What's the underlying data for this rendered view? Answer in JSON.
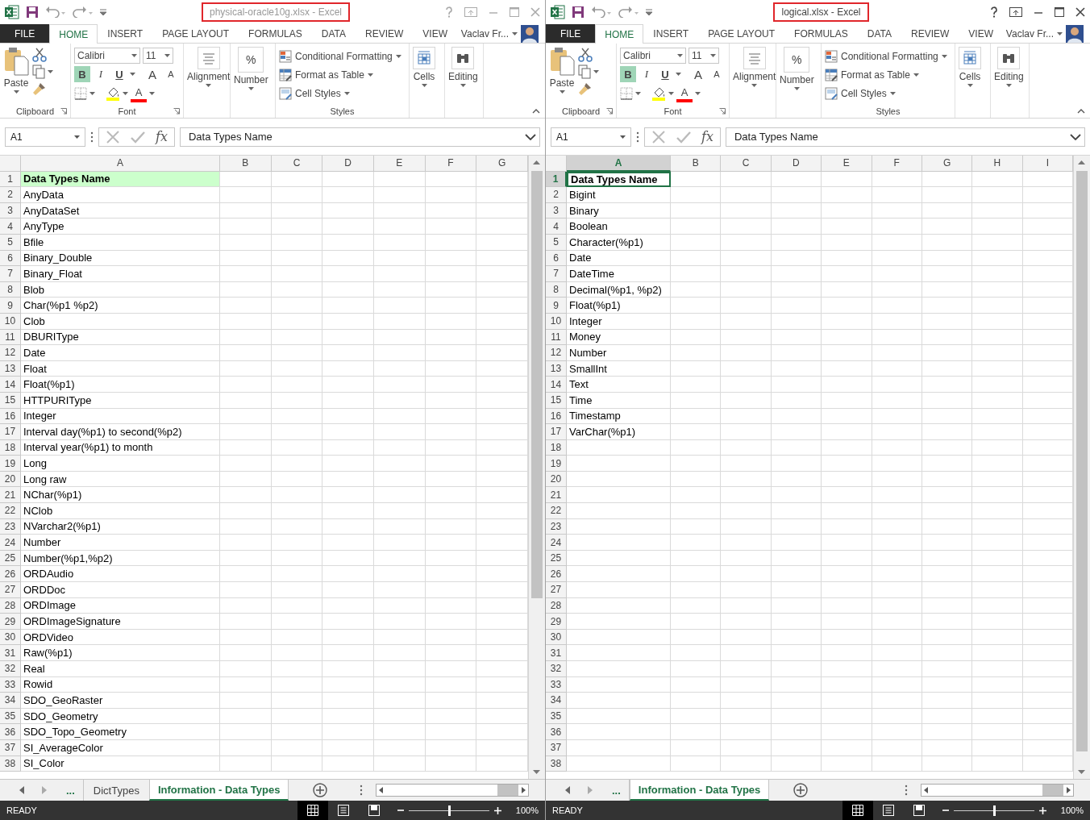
{
  "windows": [
    {
      "active": false,
      "title": "physical-oracle10g.xlsx - Excel",
      "title_marked": true,
      "tabs": [
        {
          "label": "FILE",
          "kind": "file",
          "selected": false
        },
        {
          "label": "HOME",
          "kind": "tab",
          "selected": true
        },
        {
          "label": "INSERT",
          "kind": "tab",
          "selected": false
        },
        {
          "label": "PAGE LAYOUT",
          "kind": "tab",
          "selected": false
        },
        {
          "label": "FORMULAS",
          "kind": "tab",
          "selected": false
        },
        {
          "label": "DATA",
          "kind": "tab",
          "selected": false
        },
        {
          "label": "REVIEW",
          "kind": "tab",
          "selected": false
        },
        {
          "label": "VIEW",
          "kind": "tab",
          "selected": false
        }
      ],
      "user": "Vaclav Fr...",
      "ribbon": {
        "paste": "Paste",
        "font_name": "Calibri",
        "font_size": "11",
        "bold": "B",
        "bold_on": true,
        "italic": "I",
        "underline": "U",
        "grow_font": "A",
        "shrink_font": "A",
        "font_color": "A",
        "alignment": "Alignment",
        "number_glyph": "%",
        "number": "Number",
        "styles_items": [
          "Conditional Formatting",
          "Format as Table",
          "Cell Styles"
        ],
        "cells": "Cells",
        "editing": "Editing",
        "groups": [
          "Clipboard",
          "Font",
          "Styles"
        ]
      },
      "name_box": "A1",
      "function_label": "fx",
      "formula": "Data Types Name",
      "columns": [
        {
          "label": "A",
          "selected": false
        },
        {
          "label": "B",
          "selected": false
        },
        {
          "label": "C",
          "selected": false
        },
        {
          "label": "D",
          "selected": false
        },
        {
          "label": "E",
          "selected": false
        },
        {
          "label": "F",
          "selected": false
        },
        {
          "label": "G",
          "selected": false
        }
      ],
      "header_row": {
        "n": "1",
        "text": "Data Types Name",
        "highlighted": true,
        "active": false
      },
      "rows": [
        {
          "n": "2",
          "a": "AnyData"
        },
        {
          "n": "3",
          "a": "AnyDataSet"
        },
        {
          "n": "4",
          "a": "AnyType"
        },
        {
          "n": "5",
          "a": "Bfile"
        },
        {
          "n": "6",
          "a": "Binary_Double"
        },
        {
          "n": "7",
          "a": "Binary_Float"
        },
        {
          "n": "8",
          "a": "Blob"
        },
        {
          "n": "9",
          "a": "Char(%p1 %p2)"
        },
        {
          "n": "10",
          "a": "Clob"
        },
        {
          "n": "11",
          "a": "DBURIType"
        },
        {
          "n": "12",
          "a": "Date"
        },
        {
          "n": "13",
          "a": "Float"
        },
        {
          "n": "14",
          "a": "Float(%p1)"
        },
        {
          "n": "15",
          "a": "HTTPURIType"
        },
        {
          "n": "16",
          "a": "Integer"
        },
        {
          "n": "17",
          "a": "Interval day(%p1) to second(%p2)"
        },
        {
          "n": "18",
          "a": "Interval year(%p1) to month"
        },
        {
          "n": "19",
          "a": "Long"
        },
        {
          "n": "20",
          "a": "Long raw"
        },
        {
          "n": "21",
          "a": "NChar(%p1)"
        },
        {
          "n": "22",
          "a": "NClob"
        },
        {
          "n": "23",
          "a": "NVarchar2(%p1)"
        },
        {
          "n": "24",
          "a": "Number"
        },
        {
          "n": "25",
          "a": "Number(%p1,%p2)"
        },
        {
          "n": "26",
          "a": "ORDAudio"
        },
        {
          "n": "27",
          "a": "ORDDoc"
        },
        {
          "n": "28",
          "a": "ORDImage"
        },
        {
          "n": "29",
          "a": "ORDImageSignature"
        },
        {
          "n": "30",
          "a": "ORDVideo"
        },
        {
          "n": "31",
          "a": "Raw(%p1)"
        },
        {
          "n": "32",
          "a": "Real"
        },
        {
          "n": "33",
          "a": "Rowid"
        },
        {
          "n": "34",
          "a": "SDO_GeoRaster"
        },
        {
          "n": "35",
          "a": "SDO_Geometry"
        },
        {
          "n": "36",
          "a": "SDO_Topo_Geometry"
        },
        {
          "n": "37",
          "a": "SI_AverageColor"
        },
        {
          "n": "38",
          "a": "SI_Color"
        }
      ],
      "sheet_tabs": [
        {
          "label": "...",
          "kind": "more"
        },
        {
          "label": "DictTypes",
          "kind": "sheet",
          "selected": false
        },
        {
          "label": "Information - Data Types",
          "kind": "sheet",
          "selected": true
        }
      ],
      "status": "READY",
      "zoom": {
        "level": 0.5,
        "reading": "100%"
      }
    },
    {
      "active": true,
      "title": "logical.xlsx - Excel",
      "title_marked": true,
      "tabs": [
        {
          "label": "FILE",
          "kind": "file",
          "selected": false
        },
        {
          "label": "HOME",
          "kind": "tab",
          "selected": true
        },
        {
          "label": "INSERT",
          "kind": "tab",
          "selected": false
        },
        {
          "label": "PAGE LAYOUT",
          "kind": "tab",
          "selected": false
        },
        {
          "label": "FORMULAS",
          "kind": "tab",
          "selected": false
        },
        {
          "label": "DATA",
          "kind": "tab",
          "selected": false
        },
        {
          "label": "REVIEW",
          "kind": "tab",
          "selected": false
        },
        {
          "label": "VIEW",
          "kind": "tab",
          "selected": false
        }
      ],
      "user": "Vaclav Fr...",
      "ribbon": {
        "paste": "Paste",
        "font_name": "Calibri",
        "font_size": "11",
        "bold": "B",
        "bold_on": true,
        "italic": "I",
        "underline": "U",
        "grow_font": "A",
        "shrink_font": "A",
        "font_color": "A",
        "alignment": "Alignment",
        "number_glyph": "%",
        "number": "Number",
        "styles_items": [
          "Conditional Formatting",
          "Format as Table",
          "Cell Styles"
        ],
        "cells": "Cells",
        "editing": "Editing",
        "groups": [
          "Clipboard",
          "Font",
          "Styles"
        ]
      },
      "name_box": "A1",
      "function_label": "fx",
      "formula": "Data Types Name",
      "columns": [
        {
          "label": "A",
          "selected": true
        },
        {
          "label": "B",
          "selected": false
        },
        {
          "label": "C",
          "selected": false
        },
        {
          "label": "D",
          "selected": false
        },
        {
          "label": "E",
          "selected": false
        },
        {
          "label": "F",
          "selected": false
        },
        {
          "label": "G",
          "selected": false
        },
        {
          "label": "H",
          "selected": false
        },
        {
          "label": "I",
          "selected": false
        }
      ],
      "header_row": {
        "n": "1",
        "text": "Data Types Name",
        "highlighted": false,
        "active": true
      },
      "rows": [
        {
          "n": "2",
          "a": "Bigint"
        },
        {
          "n": "3",
          "a": "Binary"
        },
        {
          "n": "4",
          "a": "Boolean"
        },
        {
          "n": "5",
          "a": "Character(%p1)"
        },
        {
          "n": "6",
          "a": "Date"
        },
        {
          "n": "7",
          "a": "DateTime"
        },
        {
          "n": "8",
          "a": "Decimal(%p1, %p2)"
        },
        {
          "n": "9",
          "a": "Float(%p1)"
        },
        {
          "n": "10",
          "a": "Integer"
        },
        {
          "n": "11",
          "a": "Money"
        },
        {
          "n": "12",
          "a": "Number"
        },
        {
          "n": "13",
          "a": "SmallInt"
        },
        {
          "n": "14",
          "a": "Text"
        },
        {
          "n": "15",
          "a": "Time"
        },
        {
          "n": "16",
          "a": "Timestamp"
        },
        {
          "n": "17",
          "a": "VarChar(%p1)"
        },
        {
          "n": "18"
        },
        {
          "n": "19"
        },
        {
          "n": "20"
        },
        {
          "n": "21"
        },
        {
          "n": "22"
        },
        {
          "n": "23"
        },
        {
          "n": "24"
        },
        {
          "n": "25"
        },
        {
          "n": "26"
        },
        {
          "n": "27"
        },
        {
          "n": "28"
        },
        {
          "n": "29"
        },
        {
          "n": "30"
        },
        {
          "n": "31"
        },
        {
          "n": "32"
        },
        {
          "n": "33"
        },
        {
          "n": "34"
        },
        {
          "n": "35"
        },
        {
          "n": "36"
        },
        {
          "n": "37"
        },
        {
          "n": "38"
        }
      ],
      "sheet_tabs": [
        {
          "label": "...",
          "kind": "more"
        },
        {
          "label": "Information - Data Types",
          "kind": "sheet",
          "selected": true
        }
      ],
      "status": "READY",
      "zoom": {
        "level": 0.5,
        "reading": "100%"
      }
    }
  ]
}
